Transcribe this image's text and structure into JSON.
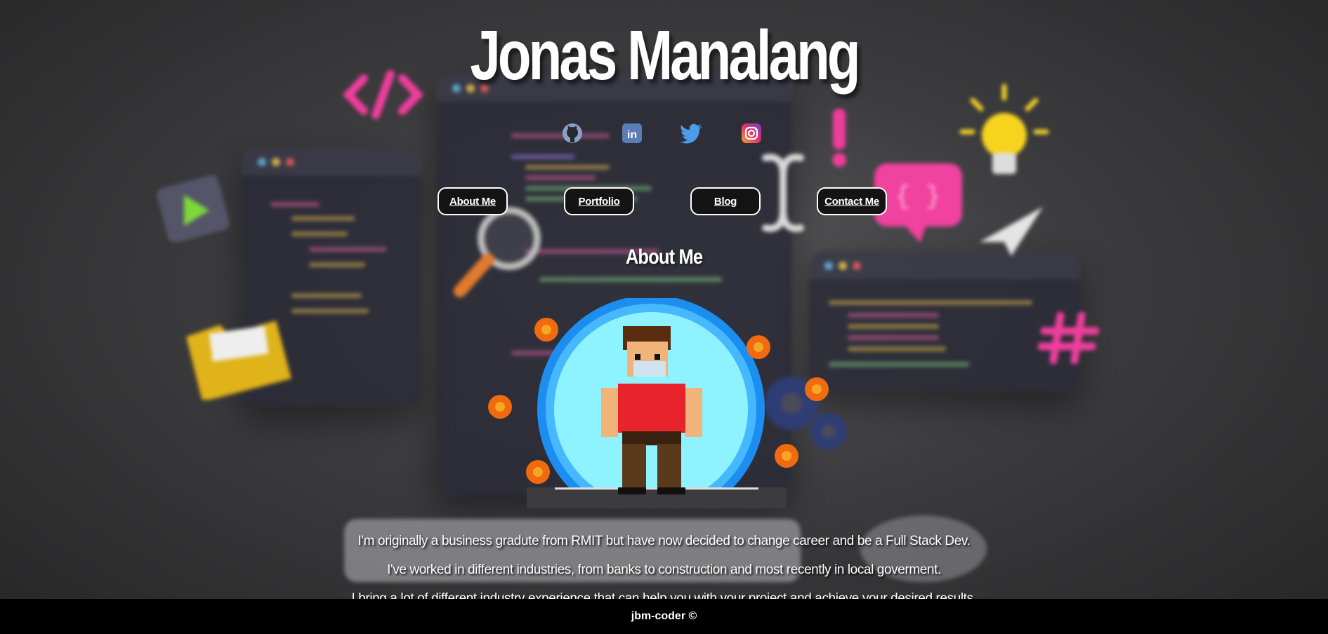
{
  "header": {
    "title": "Jonas Manalang"
  },
  "social_icons": [
    "github-icon",
    "linkedin-icon",
    "twitter-icon",
    "instagram-icon"
  ],
  "nav": {
    "about": "About Me",
    "portfolio": "Portfolio",
    "blog": "Blog",
    "contact": "Contact Me"
  },
  "section": {
    "title": "About Me"
  },
  "bio": {
    "line1": "I'm originally a business gradute from RMIT but have now decided to change career and be a Full Stack Dev.",
    "line2": "I've worked in different industries, from banks to construction and most recently in local goverment.",
    "line3": "I bring a lot of different industry experience that can help you with your project and achieve your desired results."
  },
  "footer": {
    "text": "jbm-coder ©"
  },
  "colors": {
    "background": "#3c3c3e",
    "nav_button_bg": "#141414",
    "footer_bg": "#000000",
    "avatar_glow": "#8ef3ff",
    "avatar_shirt": "#e8232b"
  }
}
